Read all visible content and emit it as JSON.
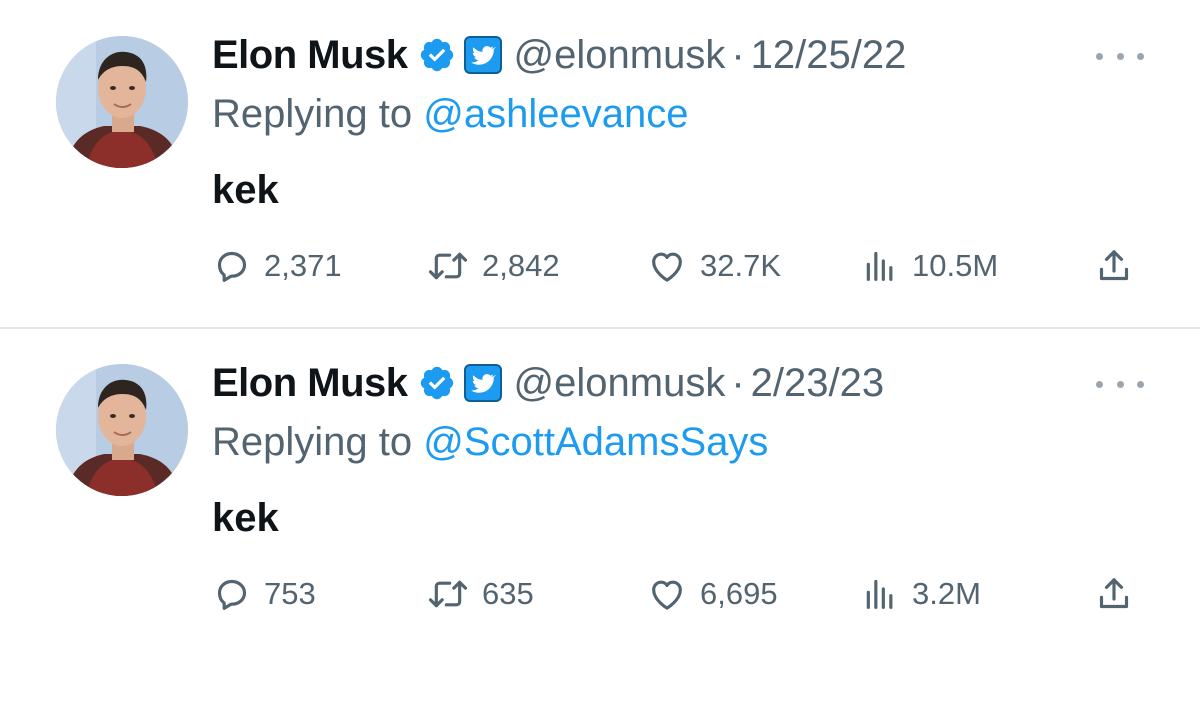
{
  "tweets": [
    {
      "author_name": "Elon Musk",
      "handle": "@elonmusk",
      "separator": "·",
      "date": "12/25/22",
      "replying_label": "Replying to ",
      "replying_to": "@ashleevance",
      "text": "kek",
      "stats": {
        "replies": "2,371",
        "retweets": "2,842",
        "likes": "32.7K",
        "views": "10.5M"
      }
    },
    {
      "author_name": "Elon Musk",
      "handle": "@elonmusk",
      "separator": "·",
      "date": "2/23/23",
      "replying_label": "Replying to ",
      "replying_to": "@ScottAdamsSays",
      "text": "kek",
      "stats": {
        "replies": "753",
        "retweets": "635",
        "likes": "6,695",
        "views": "3.2M"
      }
    }
  ],
  "icons": {
    "verified": "verified-badge-icon",
    "affiliate": "twitter-affiliate-icon",
    "more": "more-options-icon",
    "reply": "reply-icon",
    "retweet": "retweet-icon",
    "like": "heart-icon",
    "views": "views-chart-icon",
    "share": "share-icon"
  },
  "colors": {
    "accent": "#1d9bf0",
    "text_primary": "#0f1419",
    "text_secondary": "#536471",
    "divider": "#e4e7ea"
  }
}
